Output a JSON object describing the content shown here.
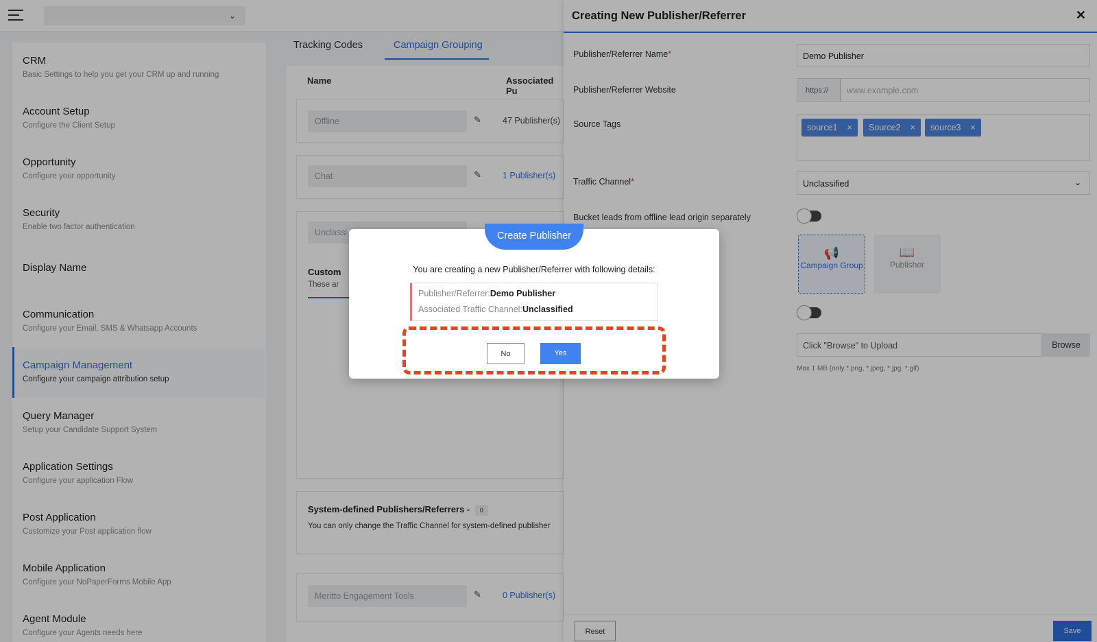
{
  "sidebar": {
    "items": [
      {
        "title": "CRM",
        "desc": "Basic Settings to help you get your CRM up and running"
      },
      {
        "title": "Account Setup",
        "desc": "Configure the Client Setup"
      },
      {
        "title": "Opportunity",
        "desc": "Configure your opportunity"
      },
      {
        "title": "Security",
        "desc": "Enable two factor authentication"
      },
      {
        "title": "Display Name",
        "desc": ""
      },
      {
        "title": "Communication",
        "desc": "Configure your Email, SMS & Whatsapp Accounts"
      },
      {
        "title": "Campaign Management",
        "desc": "Configure your campaign attribution setup"
      },
      {
        "title": "Query Manager",
        "desc": "Setup your Candidate Support System"
      },
      {
        "title": "Application Settings",
        "desc": "Configure your application Flow"
      },
      {
        "title": "Post Application",
        "desc": "Customize your Post application flow"
      },
      {
        "title": "Mobile Application",
        "desc": "Configure your NoPaperForms Mobile App"
      },
      {
        "title": "Agent Module",
        "desc": "Configure your Agents needs here"
      }
    ]
  },
  "middle": {
    "tabs": [
      "Tracking Codes",
      "Campaign Grouping"
    ],
    "columns": {
      "name": "Name",
      "associated": "Associated Pu"
    },
    "rows": [
      {
        "name": "Offline",
        "count": "47 Publisher(s)"
      },
      {
        "name": "Chat",
        "count": "1 Publisher(s)"
      },
      {
        "name": "Unclassi",
        "count": ""
      },
      {
        "name": "Meritto Engagement Tools",
        "count": "0 Publisher(s)"
      }
    ],
    "custom_title": "Custom",
    "custom_desc": "These ar",
    "system": {
      "title": "System-defined Publishers/Referrers -",
      "count": "0",
      "desc": "You can only change the Traffic Channel for system-defined publisher"
    }
  },
  "drawer": {
    "title": "Creating New Publisher/Referrer",
    "close": "✕",
    "fields": {
      "name_label": "Publisher/Referrer Name",
      "name_value": "Demo Publisher",
      "website_label": "Publisher/Referrer Website",
      "website_prefix": "https://",
      "website_placeholder": "www.example.com",
      "tags_label": "Source Tags",
      "tags": [
        "source1",
        "Source2",
        "source3"
      ],
      "traffic_label": "Traffic Channel",
      "traffic_value": "Unclassified",
      "bucket_label": "Bucket leads from offline lead origin separately",
      "choice_group": "Campaign Group",
      "choice_publisher": "Publisher",
      "upload_placeholder": "Click \"Browse\" to Upload",
      "browse": "Browse",
      "upload_hint": "Max 1 MB (only *.png, *.jpeg, *.jpg, *.gif)"
    },
    "footer": {
      "reset": "Reset",
      "save": "Save"
    }
  },
  "modal": {
    "badge": "Create Publisher",
    "message": "You are creating a new Publisher/Referrer with following details:",
    "publisher_label": "Publisher/Referrer:",
    "publisher_value": "Demo Publisher",
    "channel_label": "Associated Traffic Channel:",
    "channel_value": "Unclassified",
    "no": "No",
    "yes": "Yes"
  },
  "colors": {
    "accent": "#2f6fd8",
    "highlight": "#e8431f",
    "required": "#e53935"
  },
  "icons": [
    "menu-icon",
    "chevron-down-icon",
    "pencil-icon",
    "close-icon",
    "megaphone-icon",
    "book-icon"
  ]
}
